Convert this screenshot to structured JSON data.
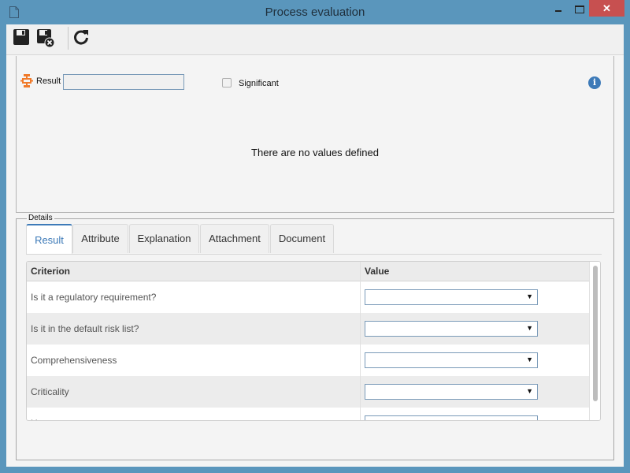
{
  "window": {
    "title": "Process evaluation",
    "close_glyph": "✕"
  },
  "toolbar": {
    "buttons": [
      {
        "name": "save",
        "icon": "floppy-disk-icon"
      },
      {
        "name": "save-and-close",
        "icon": "floppy-disk-close-icon"
      },
      {
        "name": "refresh",
        "icon": "refresh-icon"
      }
    ]
  },
  "header_panel": {
    "result_label": "Result",
    "result_value": "",
    "significant_label": "Significant",
    "significant_checked": false,
    "info_glyph": "i",
    "empty_message": "There are no values defined"
  },
  "details": {
    "legend": "Details",
    "tabs": [
      {
        "label": "Result",
        "active": true
      },
      {
        "label": "Attribute",
        "active": false
      },
      {
        "label": "Explanation",
        "active": false
      },
      {
        "label": "Attachment",
        "active": false
      },
      {
        "label": "Document",
        "active": false
      }
    ],
    "grid": {
      "columns": [
        "Criterion",
        "Value"
      ],
      "rows": [
        {
          "criterion": "Is it a regulatory requirement?",
          "value": ""
        },
        {
          "criterion": "Is it in the default risk list?",
          "value": ""
        },
        {
          "criterion": "Comprehensiveness",
          "value": ""
        },
        {
          "criterion": "Criticality",
          "value": ""
        },
        {
          "criterion": "Urgency",
          "value": ""
        }
      ],
      "dropdown_arrow": "▼"
    }
  }
}
